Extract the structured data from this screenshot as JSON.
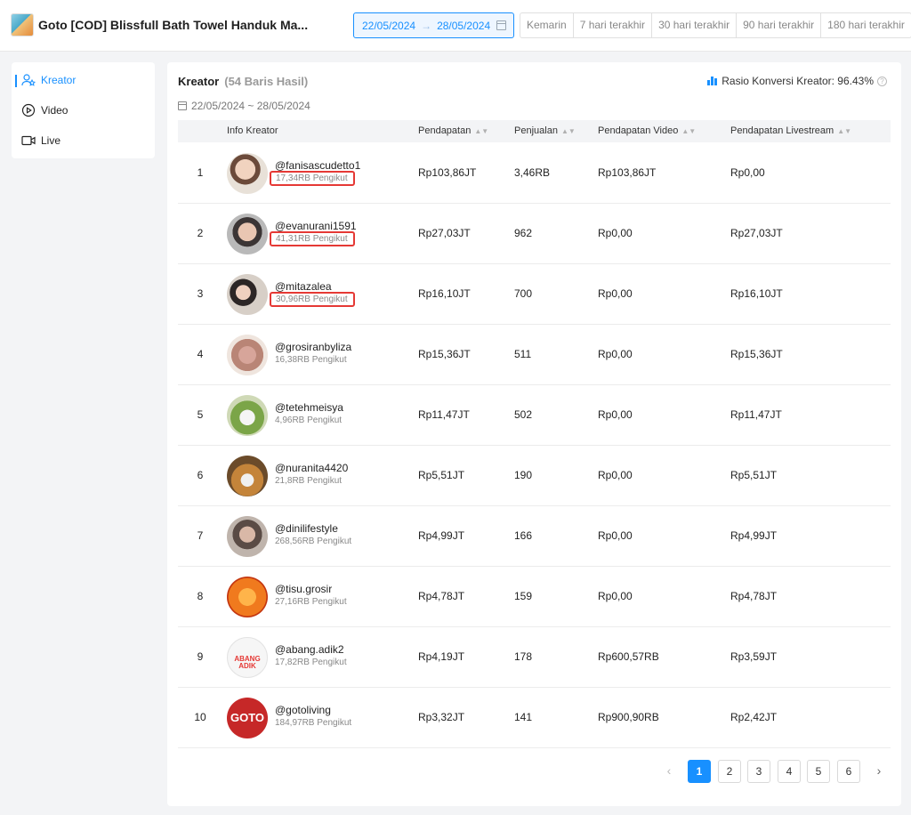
{
  "header": {
    "product_title": "Goto [COD] Blissfull Bath Towel Handuk Ma...",
    "date_range": {
      "start": "22/05/2024",
      "arrow": "→",
      "end": "28/05/2024"
    },
    "quick_ranges": [
      "Kemarin",
      "7 hari terakhir",
      "30 hari terakhir",
      "90 hari terakhir",
      "180 hari terakhir"
    ]
  },
  "sidebar": {
    "items": [
      {
        "label": "Kreator",
        "icon": "users-icon",
        "active": true
      },
      {
        "label": "Video",
        "icon": "play-circle-icon",
        "active": false
      },
      {
        "label": "Live",
        "icon": "video-camera-icon",
        "active": false
      }
    ]
  },
  "main": {
    "title": "Kreator",
    "count": "(54 Baris Hasil)",
    "ratio_text": "Rasio Konversi Kreator: 96.43%",
    "date_sub": "22/05/2024 ~ 28/05/2024",
    "columns": [
      "Info Kreator",
      "Pendapatan",
      "Penjualan",
      "Pendapatan Video",
      "Pendapatan Livestream"
    ],
    "rows": [
      {
        "rank": "1",
        "handle": "@fanisascudetto1",
        "followers": "17,34RB Pengikut",
        "revenue": "Rp103,86JT",
        "sales": "3,46RB",
        "video": "Rp103,86JT",
        "live": "Rp0,00",
        "highlight": true
      },
      {
        "rank": "2",
        "handle": "@evanurani1591",
        "followers": "41,31RB Pengikut",
        "revenue": "Rp27,03JT",
        "sales": "962",
        "video": "Rp0,00",
        "live": "Rp27,03JT",
        "highlight": true
      },
      {
        "rank": "3",
        "handle": "@mitazalea",
        "followers": "30,96RB Pengikut",
        "revenue": "Rp16,10JT",
        "sales": "700",
        "video": "Rp0,00",
        "live": "Rp16,10JT",
        "highlight": true
      },
      {
        "rank": "4",
        "handle": "@grosiranbyliza",
        "followers": "16,38RB Pengikut",
        "revenue": "Rp15,36JT",
        "sales": "511",
        "video": "Rp0,00",
        "live": "Rp15,36JT",
        "highlight": false
      },
      {
        "rank": "5",
        "handle": "@tetehmeisya",
        "followers": "4,96RB Pengikut",
        "revenue": "Rp11,47JT",
        "sales": "502",
        "video": "Rp0,00",
        "live": "Rp11,47JT",
        "highlight": false
      },
      {
        "rank": "6",
        "handle": "@nuranita4420",
        "followers": "21,8RB Pengikut",
        "revenue": "Rp5,51JT",
        "sales": "190",
        "video": "Rp0,00",
        "live": "Rp5,51JT",
        "highlight": false
      },
      {
        "rank": "7",
        "handle": "@dinilifestyle",
        "followers": "268,56RB Pengikut",
        "revenue": "Rp4,99JT",
        "sales": "166",
        "video": "Rp0,00",
        "live": "Rp4,99JT",
        "highlight": false
      },
      {
        "rank": "8",
        "handle": "@tisu.grosir",
        "followers": "27,16RB Pengikut",
        "revenue": "Rp4,78JT",
        "sales": "159",
        "video": "Rp0,00",
        "live": "Rp4,78JT",
        "highlight": false
      },
      {
        "rank": "9",
        "handle": "@abang.adik2",
        "followers": "17,82RB Pengikut",
        "revenue": "Rp4,19JT",
        "sales": "178",
        "video": "Rp600,57RB",
        "live": "Rp3,59JT",
        "highlight": false,
        "logo_text": "ABANG ADIK"
      },
      {
        "rank": "10",
        "handle": "@gotoliving",
        "followers": "184,97RB Pengikut",
        "revenue": "Rp3,32JT",
        "sales": "141",
        "video": "Rp900,90RB",
        "live": "Rp2,42JT",
        "highlight": false,
        "logo_text": "GOTO"
      }
    ]
  },
  "pagination": {
    "prev": "‹",
    "pages": [
      "1",
      "2",
      "3",
      "4",
      "5",
      "6"
    ],
    "active": "1",
    "next": "›"
  },
  "colors": {
    "accent": "#1890ff",
    "highlight_box": "#e53935"
  }
}
